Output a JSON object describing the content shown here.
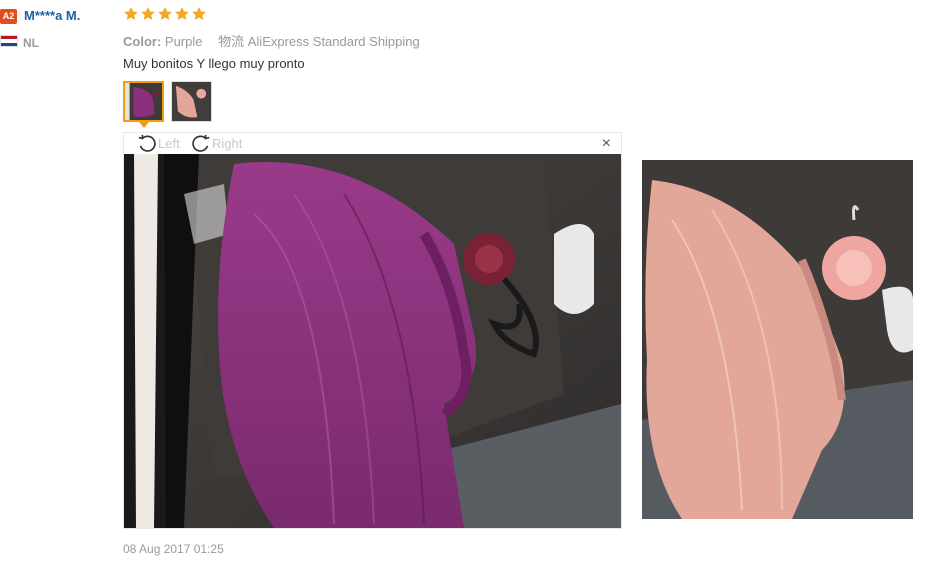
{
  "user": {
    "level_badge": "A2",
    "name": "M****a M.",
    "country": "NL"
  },
  "review": {
    "rating": 5,
    "attributes": {
      "color_label": "Color:",
      "color_value": "Purple",
      "shipping_label": "物流",
      "shipping_value": "AliExpress Standard Shipping"
    },
    "text": "Muy bonitos Y llego muy pronto",
    "date": "08 Aug 2017 01:25"
  },
  "viewer": {
    "rotate_left_label": "Left",
    "rotate_right_label": "Right",
    "close_glyph": "×"
  },
  "colors": {
    "star": "#f5a623",
    "username": "#1b5fa8",
    "badge": "#e14d1c",
    "active_thumb_border": "#f39c12",
    "skirt_purple": "#8b2f7c",
    "skirt_pink": "#e3a79a"
  }
}
